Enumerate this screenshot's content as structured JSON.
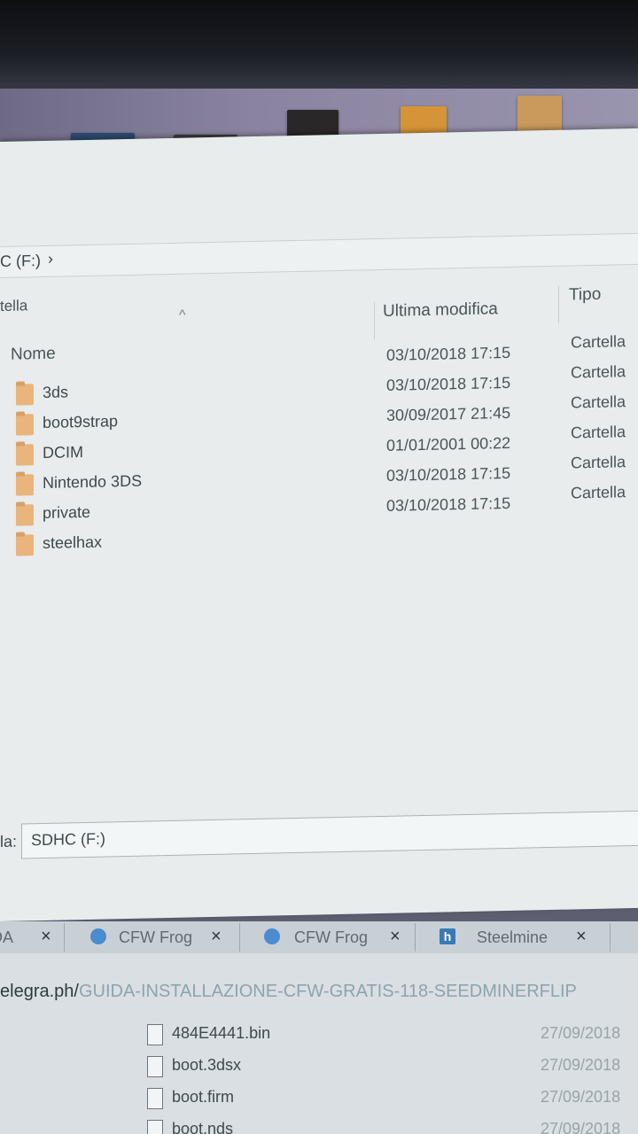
{
  "taskbar_thumbnails": [
    {
      "name": "thumb-1",
      "color": "#9ea5b0"
    },
    {
      "name": "thumb-2",
      "color": "#2c4a6e"
    },
    {
      "name": "thumb-3",
      "color": "#3a3b3f"
    },
    {
      "name": "thumb-4",
      "color": "#2a2728"
    },
    {
      "name": "thumb-5",
      "color": "#d59437"
    },
    {
      "name": "thumb-6",
      "color": "#c99a5c"
    }
  ],
  "explorer": {
    "address": "C (F:)",
    "address_chevron": "›",
    "tree_label": "tella",
    "sort_arrow": "^",
    "columns": {
      "name": "Nome",
      "modified": "Ultima modifica",
      "type": "Tipo"
    },
    "files": [
      {
        "name": "3ds",
        "modified": "03/10/2018 17:15",
        "type": "Cartella"
      },
      {
        "name": "boot9strap",
        "modified": "03/10/2018 17:15",
        "type": "Cartella"
      },
      {
        "name": "DCIM",
        "modified": "30/09/2017 21:45",
        "type": "Cartella"
      },
      {
        "name": "Nintendo 3DS",
        "modified": "01/01/2001 00:22",
        "type": "Cartella"
      },
      {
        "name": "private",
        "modified": "03/10/2018 17:15",
        "type": "Cartella"
      },
      {
        "name": "steelhax",
        "modified": "03/10/2018 17:15",
        "type": "Cartella"
      }
    ],
    "path_label": "la:",
    "path_value": "SDHC (F:)"
  },
  "browser": {
    "tabs": [
      {
        "label": "DA",
        "close": "×",
        "icon": "none"
      },
      {
        "label": "CFW Frog",
        "close": "×",
        "icon": "circle"
      },
      {
        "label": "CFW Frog",
        "close": "×",
        "icon": "circle"
      },
      {
        "label": "Steelmine",
        "close": "×",
        "icon": "h"
      }
    ],
    "url_host": "elegra.ph/",
    "url_path": "GUIDA-INSTALLAZIONE-CFW-GRATIS-118-SEEDMINERFLIP",
    "downloads": [
      {
        "name": "484E4441.bin",
        "date": "27/09/2018"
      },
      {
        "name": "boot.3dsx",
        "date": "27/09/2018"
      },
      {
        "name": "boot.firm",
        "date": "27/09/2018"
      },
      {
        "name": "boot.nds",
        "date": "27/09/2018"
      }
    ]
  }
}
